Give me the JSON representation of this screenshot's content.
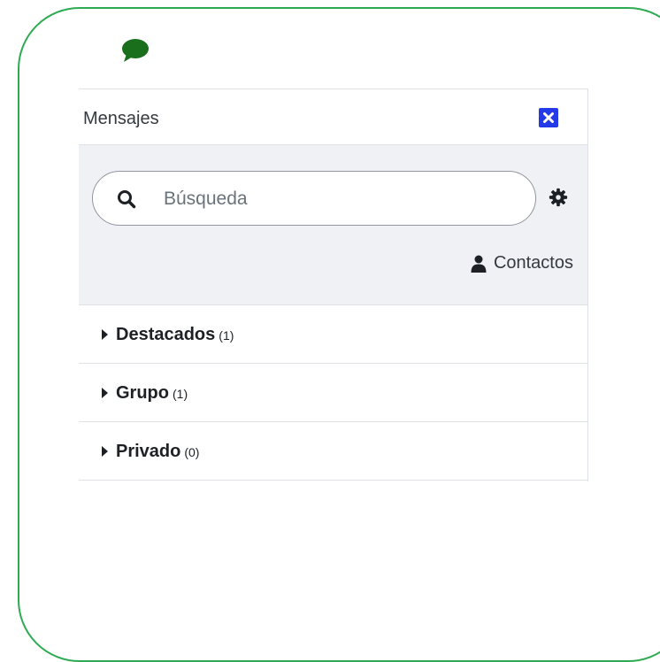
{
  "drawer": {
    "title": "Mensajes",
    "close_icon": "close-icon",
    "toggle_icon": "chat-bubble-icon"
  },
  "search": {
    "placeholder": "Búsqueda",
    "value": ""
  },
  "settings": {
    "icon": "gear-icon"
  },
  "contacts": {
    "label": "Contactos",
    "icon": "user-icon"
  },
  "sections": [
    {
      "label": "Destacados",
      "count": "(1)"
    },
    {
      "label": "Grupo",
      "count": "(1)"
    },
    {
      "label": "Privado",
      "count": "(0)"
    }
  ],
  "colors": {
    "frame": "#2eab52",
    "chat_icon": "#1a6f1c",
    "close_button": "#2439e8",
    "search_area_bg": "#eff1f4"
  }
}
